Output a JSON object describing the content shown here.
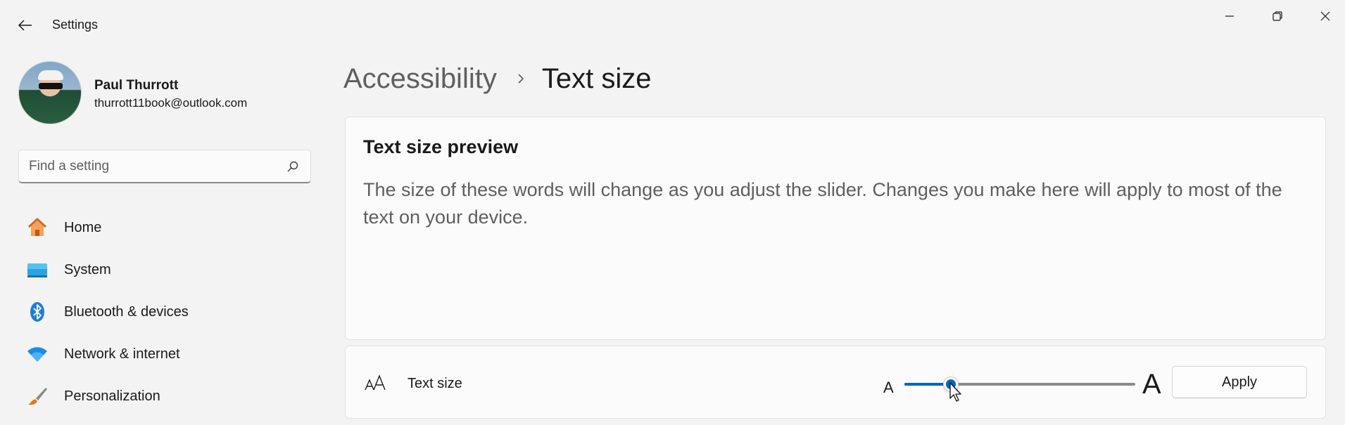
{
  "window": {
    "title": "Settings",
    "controls": [
      "minimize",
      "restore",
      "close"
    ]
  },
  "profile": {
    "name": "Paul Thurrott",
    "email": "thurrott11book@outlook.com"
  },
  "search": {
    "placeholder": "Find a setting"
  },
  "nav": {
    "items": [
      {
        "label": "Home",
        "icon": "home-icon"
      },
      {
        "label": "System",
        "icon": "monitor-icon"
      },
      {
        "label": "Bluetooth & devices",
        "icon": "bluetooth-icon"
      },
      {
        "label": "Network & internet",
        "icon": "wifi-icon"
      },
      {
        "label": "Personalization",
        "icon": "brush-icon"
      }
    ]
  },
  "breadcrumb": {
    "parent": "Accessibility",
    "current": "Text size"
  },
  "preview": {
    "title": "Text size preview",
    "body": "The size of these words will change as you adjust the slider. Changes you make here will apply to most of the text on your device."
  },
  "text_size": {
    "label": "Text size",
    "min_glyph": "A",
    "max_glyph": "A",
    "value_fraction": 0.2,
    "apply_label": "Apply"
  },
  "colors": {
    "accent": "#0067c0",
    "background": "#f3f3f3",
    "card": "#fbfbfb"
  }
}
